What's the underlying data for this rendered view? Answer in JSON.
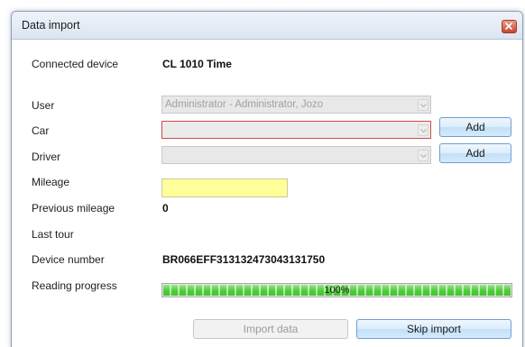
{
  "window": {
    "title": "Data import"
  },
  "form": {
    "connected_device": {
      "label": "Connected device",
      "value": "CL 1010 Time"
    },
    "user": {
      "label": "User",
      "value": "Administrator - Administrator, Jozo"
    },
    "car": {
      "label": "Car",
      "value": "",
      "add_label": "Add"
    },
    "driver": {
      "label": "Driver",
      "value": "",
      "add_label": "Add"
    },
    "mileage": {
      "label": "Mileage",
      "value": ""
    },
    "previous_mileage": {
      "label": "Previous mileage",
      "value": "0"
    },
    "last_tour": {
      "label": "Last tour",
      "value": ""
    },
    "device_number": {
      "label": "Device number",
      "value": "BR066EFF313132473043131750"
    },
    "reading_progress": {
      "label": "Reading progress",
      "percent": 100,
      "text": "100%"
    }
  },
  "actions": {
    "import_label": "Import data",
    "skip_label": "Skip import"
  },
  "colors": {
    "progress_fill": "#4fcf3a",
    "mileage_highlight": "#ffff9a",
    "error_border": "#d04a4a",
    "button_border": "#6f9fcf"
  }
}
